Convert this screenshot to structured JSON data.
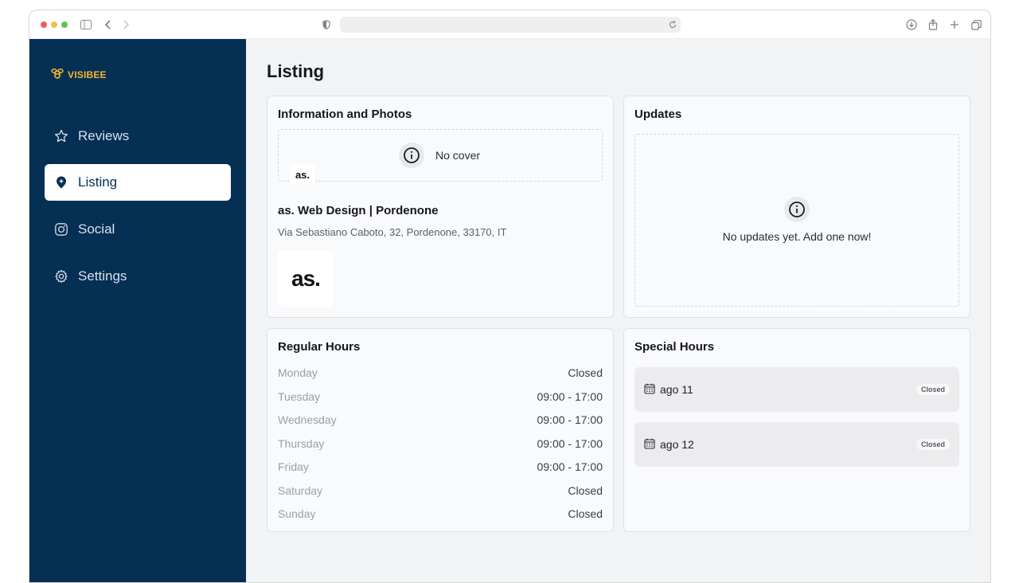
{
  "app": {
    "brand": "VISIBEE",
    "page_title": "Listing"
  },
  "sidebar": {
    "items": [
      {
        "label": "Reviews",
        "icon": "star-icon"
      },
      {
        "label": "Listing",
        "icon": "map-pin-icon",
        "active": true
      },
      {
        "label": "Social",
        "icon": "instagram-icon"
      },
      {
        "label": "Settings",
        "icon": "gear-icon"
      }
    ]
  },
  "info_card": {
    "title": "Information and Photos",
    "cover_text": "No cover",
    "avatar_text": "as.",
    "business_name": "as. Web Design | Pordenone",
    "address": "Via Sebastiano Caboto, 32, Pordenone, 33170, IT",
    "logo_text": "as."
  },
  "updates_card": {
    "title": "Updates",
    "empty_text": "No updates yet. Add one now!"
  },
  "regular_hours": {
    "title": "Regular Hours",
    "rows": [
      {
        "day": "Monday",
        "time": "Closed"
      },
      {
        "day": "Tuesday",
        "time": "09:00 - 17:00"
      },
      {
        "day": "Wednesday",
        "time": "09:00 - 17:00"
      },
      {
        "day": "Thursday",
        "time": "09:00 - 17:00"
      },
      {
        "day": "Friday",
        "time": "09:00 - 17:00"
      },
      {
        "day": "Saturday",
        "time": "Closed"
      },
      {
        "day": "Sunday",
        "time": "Closed"
      }
    ]
  },
  "special_hours": {
    "title": "Special Hours",
    "items": [
      {
        "date": "ago 11",
        "status": "Closed"
      },
      {
        "date": "ago 12",
        "status": "Closed"
      }
    ]
  },
  "colors": {
    "sidebar_bg": "#062f54",
    "brand_accent": "#f5b731",
    "page_bg": "#f2f3f5"
  }
}
